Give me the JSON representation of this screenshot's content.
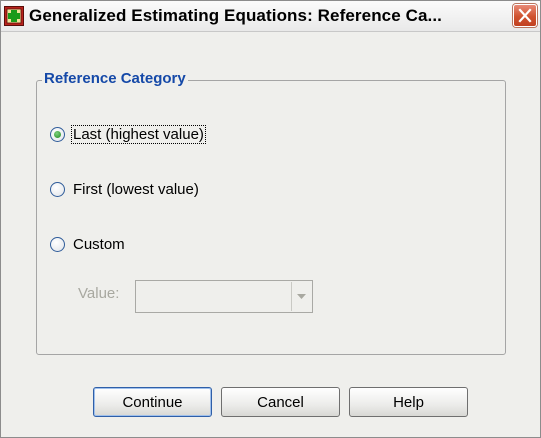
{
  "window": {
    "title": "Generalized Estimating Equations: Reference Ca..."
  },
  "group": {
    "title": "Reference Category",
    "options": [
      {
        "label": "Last (highest value)",
        "selected": true
      },
      {
        "label": "First (lowest value)",
        "selected": false
      },
      {
        "label": "Custom",
        "selected": false
      }
    ],
    "value": {
      "label": "Value:",
      "current": "",
      "enabled": false
    }
  },
  "buttons": {
    "continue": "Continue",
    "cancel": "Cancel",
    "help": "Help"
  },
  "icons": {
    "app": "spss-dialog-icon",
    "close": "close-icon",
    "dropdown": "chevron-down-icon"
  },
  "colors": {
    "group_title": "#1549a8",
    "close_button": "#d0522e",
    "radio_selected": "#1f8a1f",
    "disabled_text": "#a8a8a0"
  }
}
